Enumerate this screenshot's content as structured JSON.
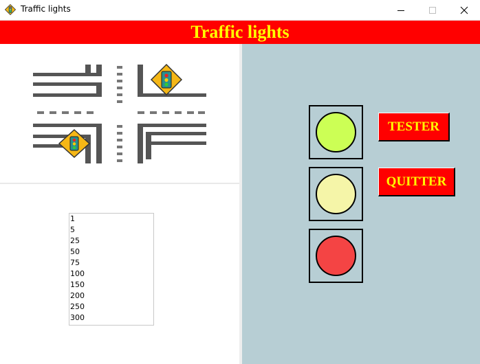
{
  "window": {
    "title": "Traffic lights",
    "icon": "traffic-light-sign-icon",
    "controls": [
      "minimize-icon",
      "maximize-icon",
      "close-icon"
    ]
  },
  "banner": {
    "text": "Traffic lights",
    "bg": "#ff0000",
    "fg": "#ffff00"
  },
  "list": {
    "items": [
      "1",
      "5",
      "25",
      "50",
      "75",
      "100",
      "150",
      "200",
      "250",
      "300"
    ]
  },
  "lights": {
    "green": "#ccff55",
    "yellow": "#f5f5a8",
    "red": "#f44444",
    "panel_bg": "#b7ced4"
  },
  "buttons": {
    "tester": "TESTER",
    "quitter": "QUITTER"
  }
}
